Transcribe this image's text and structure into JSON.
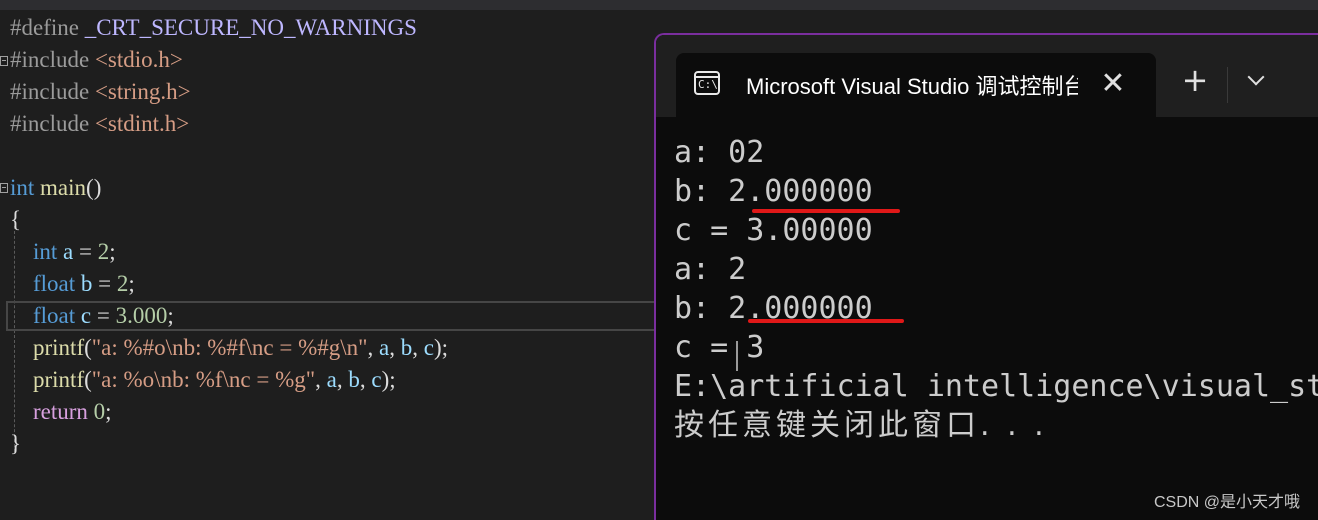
{
  "editor": {
    "lines": [
      {
        "id": "line-define",
        "tokens": [
          {
            "t": "#define ",
            "c": "tok-pp"
          },
          {
            "t": "_CRT_SECURE_NO_WARNINGS",
            "c": "tok-macro"
          }
        ]
      },
      {
        "id": "line-include-stdio",
        "tokens": [
          {
            "t": "#include ",
            "c": "tok-pp"
          },
          {
            "t": "<stdio.h>",
            "c": "tok-str"
          }
        ]
      },
      {
        "id": "line-include-string",
        "tokens": [
          {
            "t": "#include ",
            "c": "tok-pp"
          },
          {
            "t": "<string.h>",
            "c": "tok-str"
          }
        ]
      },
      {
        "id": "line-include-stdint",
        "tokens": [
          {
            "t": "#include ",
            "c": "tok-pp"
          },
          {
            "t": "<stdint.h>",
            "c": "tok-str"
          }
        ]
      },
      {
        "id": "line-blank",
        "tokens": []
      },
      {
        "id": "line-main-signature",
        "tokens": [
          {
            "t": "int ",
            "c": "tok-kw"
          },
          {
            "t": "main",
            "c": "tok-fn"
          },
          {
            "t": "()",
            "c": "tok-text"
          }
        ]
      },
      {
        "id": "line-open-brace",
        "tokens": [
          {
            "t": "{",
            "c": "tok-text"
          }
        ]
      },
      {
        "id": "line-int-a",
        "tokens": [
          {
            "t": "    int ",
            "c": "tok-kw"
          },
          {
            "t": "a",
            "c": "tok-var"
          },
          {
            "t": " = ",
            "c": "tok-text"
          },
          {
            "t": "2",
            "c": "tok-num"
          },
          {
            "t": ";",
            "c": "tok-text"
          }
        ]
      },
      {
        "id": "line-float-b",
        "tokens": [
          {
            "t": "    float ",
            "c": "tok-kw"
          },
          {
            "t": "b",
            "c": "tok-var"
          },
          {
            "t": " = ",
            "c": "tok-text"
          },
          {
            "t": "2",
            "c": "tok-num"
          },
          {
            "t": ";",
            "c": "tok-text"
          }
        ]
      },
      {
        "id": "line-float-c",
        "tokens": [
          {
            "t": "    float ",
            "c": "tok-kw"
          },
          {
            "t": "c",
            "c": "tok-var"
          },
          {
            "t": " = ",
            "c": "tok-text"
          },
          {
            "t": "3.000",
            "c": "tok-num"
          },
          {
            "t": ";",
            "c": "tok-text"
          }
        ]
      },
      {
        "id": "line-printf-1",
        "tokens": [
          {
            "t": "    printf",
            "c": "tok-fn"
          },
          {
            "t": "(",
            "c": "tok-text"
          },
          {
            "t": "\"a: %#o\\nb: %#f\\nc = %#g\\n\"",
            "c": "tok-str"
          },
          {
            "t": ", ",
            "c": "tok-text"
          },
          {
            "t": "a",
            "c": "tok-var"
          },
          {
            "t": ", ",
            "c": "tok-text"
          },
          {
            "t": "b",
            "c": "tok-var"
          },
          {
            "t": ", ",
            "c": "tok-text"
          },
          {
            "t": "c",
            "c": "tok-var"
          },
          {
            "t": ");",
            "c": "tok-text"
          }
        ]
      },
      {
        "id": "line-printf-2",
        "tokens": [
          {
            "t": "    printf",
            "c": "tok-fn"
          },
          {
            "t": "(",
            "c": "tok-text"
          },
          {
            "t": "\"a: %o\\nb: %f\\nc = %g\"",
            "c": "tok-str"
          },
          {
            "t": ", ",
            "c": "tok-text"
          },
          {
            "t": "a",
            "c": "tok-var"
          },
          {
            "t": ", ",
            "c": "tok-text"
          },
          {
            "t": "b",
            "c": "tok-var"
          },
          {
            "t": ", ",
            "c": "tok-text"
          },
          {
            "t": "c",
            "c": "tok-var"
          },
          {
            "t": ");",
            "c": "tok-text"
          }
        ]
      },
      {
        "id": "line-return",
        "tokens": [
          {
            "t": "    return ",
            "c": "tok-ret"
          },
          {
            "t": "0",
            "c": "tok-num"
          },
          {
            "t": ";",
            "c": "tok-text"
          }
        ]
      },
      {
        "id": "line-close-brace",
        "tokens": [
          {
            "t": "}",
            "c": "tok-text"
          }
        ]
      }
    ]
  },
  "terminal": {
    "tab_title": "Microsoft Visual Studio 调试控制台",
    "tab_icon": "console-icon",
    "tab_icon_glyph": "C:\\",
    "close_glyph": "✕",
    "new_tab_glyph": "+",
    "output_lines": [
      "a: 02",
      "b: 2.000000",
      "c = 3.00000",
      "a: 2",
      "b: 2.000000",
      "c = 3",
      "E:\\artificial intelligence\\visual_studio_code\\test.exe",
      "按任意键关闭此窗口. . ."
    ],
    "underline_color": "#e01818",
    "border_accent": "#7a2e9e"
  },
  "watermark": "CSDN @是小天才哦"
}
